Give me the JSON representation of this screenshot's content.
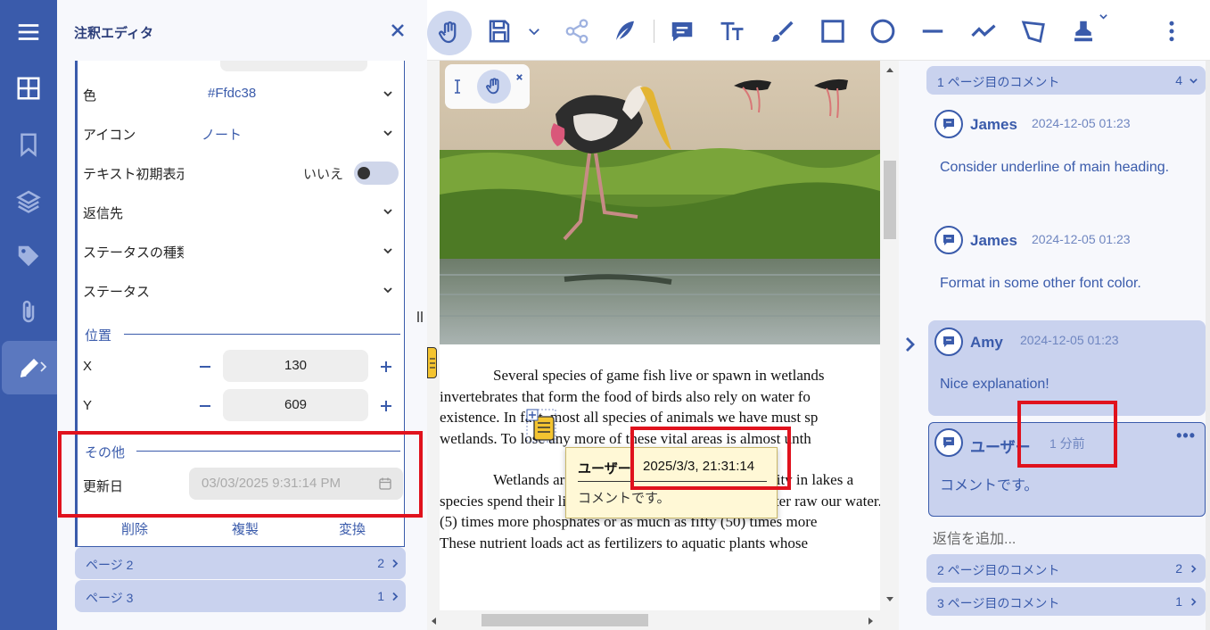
{
  "editor": {
    "title": "注釈エディタ",
    "fields": {
      "color_label": "色",
      "color_value": "#Ffdc38",
      "icon_label": "アイコン",
      "icon_value": "ノート",
      "initial_display_label": "テキスト初期表示",
      "initial_display_value": "いいえ",
      "reply_to_label": "返信先",
      "status_kind_label": "ステータスの種類",
      "status_label": "ステータス"
    },
    "position": {
      "title": "位置",
      "x_label": "X",
      "x_value": "130",
      "y_label": "Y",
      "y_value": "609"
    },
    "other": {
      "title": "その他",
      "updated_label": "更新日",
      "updated_value": "03/03/2025 9:31:14 PM"
    },
    "actions": {
      "delete": "削除",
      "duplicate": "複製",
      "convert": "変換"
    },
    "pages": [
      {
        "label": "ページ 2",
        "count": "2"
      },
      {
        "label": "ページ 3",
        "count": "1"
      }
    ]
  },
  "document": {
    "para1": [
      "Several species of game fish live or spawn in wetlands",
      "invertebrates that form the food of birds also rely on water fo",
      "existence. In fact, most all species of animals we have must sp",
      "wetlands. To lose any more of these vital areas is almost unth"
    ],
    "para2": [
      "Wetlands are critical to maintaining water quality in lakes a",
      "species spend their lives in the water. They also help filter raw our water. W",
      "(5) times more phosphates or as much as fifty (50) times more",
      "These nutrient loads act as fertilizers to aquatic plants whose"
    ],
    "tooltip": {
      "author": "ユーザー",
      "date": "2025/3/3, 21:31:14",
      "body": "コメントです。"
    }
  },
  "comments": {
    "groups": [
      {
        "label": "1 ページ目のコメント",
        "count": "4"
      },
      {
        "label": "2 ページ目のコメント",
        "count": "2"
      },
      {
        "label": "3 ページ目のコメント",
        "count": "1"
      }
    ],
    "items": [
      {
        "author": "James",
        "time": "2024-12-05 01:23",
        "text": "Consider underline of main heading."
      },
      {
        "author": "James",
        "time": "2024-12-05 01:23",
        "text": "Format in some other font color."
      },
      {
        "author": "Amy",
        "time": "2024-12-05 01:23",
        "text": "Nice explanation!"
      },
      {
        "author": "ユーザー",
        "time": "1 分前",
        "text": "コメントです。"
      }
    ],
    "reply_placeholder": "返信を追加...",
    "more": "•••"
  },
  "colors": {
    "accent": "#3a5bab",
    "pill": "#c9d2ee",
    "highlight_box": "#e0121d",
    "note": "#f4c430"
  }
}
